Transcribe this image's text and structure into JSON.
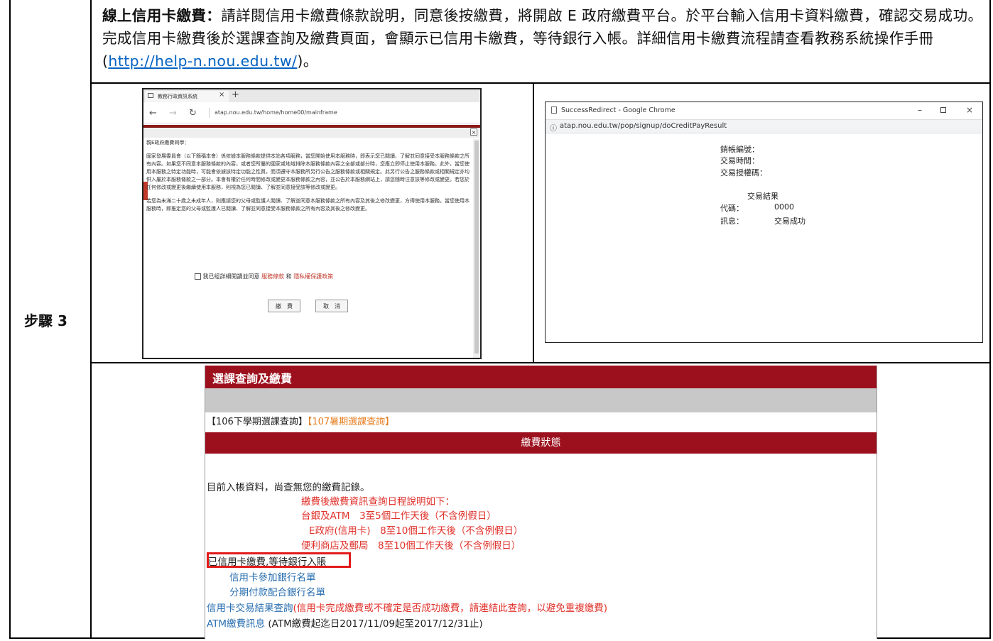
{
  "step": {
    "label": "步驟 3"
  },
  "intro": {
    "heading": "線上信用卡繳費：",
    "text": "請詳閱信用卡繳費條款說明，同意後按繳費，將開啟 E 政府繳費平台。於平台輸入信用卡資料繳費，確認交易成功。完成信用卡繳費後於選課查詢及繳費頁面，會顯示已信用卡繳費，等待銀行入帳。詳細信用卡繳費流程請查看教務系統操作手冊(",
    "link": "http://help-n.nou.edu.tw/",
    "tail": ")。"
  },
  "shot1": {
    "tab_title": "教務行政資訊系統",
    "url": "atap.nou.edu.tw/home/home00/mainframe",
    "greeting": "親E政府繳費同學：",
    "para1": "國家發展委員會（以下簡稱本會）係依據本服務條款提供本站各項服務，當您開始使用本服務時，即表示您已閱讀、了解並同意接受本服務條款之所有內容。如果您不同意本服務條款的內容，或者您所屬的國家或地域排除本服務條款內容之全部或部分時，您應立即停止使用本服務。此外，當您使用本服務之特定功能時，可能會依據該特定功能之性質，而須遵守本服務所另行公告之服務條款或相關規定。此另行公告之服務條款或相關規定亦均併入屬於本服務條款之一部分。本會有權於任何時間修改或變更本服務條款之內容，並公告於本服務網站上，請您隨時注意該等修改或變更。若您於任何修改或變更後繼續使用本服務，則視為您已閱讀、了解並同意接受該等修改或變更。",
    "para2": "若您為未滿二十歲之未成年人，則應請您的父母或監護人閱讀、了解並同意本服務條款之所有內容及其後之修改變更，方得使用本服務。當您使用本服務時，即推定您的父母或監護人已閱讀、了解並同意接受本服務條款之所有內容及其後之修改變更。",
    "agree_prefix": "我已經詳細閱讀並同意",
    "terms_link": "服務條款",
    "and": "和",
    "privacy_link": "隱私權保護政策",
    "pay_button": "繳　費",
    "cancel_button": "取　消"
  },
  "shot2": {
    "window_title": "SuccessRedirect - Google Chrome",
    "url": "atap.nou.edu.tw/pop/signup/doCreditPayResult",
    "account_label": "銷帳編號：",
    "time_label": "交易時間：",
    "auth_label": "交易授權碼：",
    "result_title": "交易結果",
    "code_label": "代碼：",
    "code_value": "0000",
    "msg_label": "訊息：",
    "msg_value": "交易成功"
  },
  "shot3": {
    "header": "選課查詢及繳費",
    "link_106": "【106下學期選課查詢】",
    "link_107": "【107暑期選課查詢】",
    "status_title": "繳費狀態",
    "no_record": "目前入帳資料，尚查無您的繳費記錄。",
    "info_title": "繳費後繳費資訊查詢日程說明如下：",
    "info_atm": "台銀及ATM　3至5個工作天後（不含例假日）",
    "info_egov": "E政府(信用卡)　8至10個工作天後（不含例假日）",
    "info_store": "便利商店及郵局　8至10個工作天後（不含例假日）",
    "paid_status": "已信用卡繳費,等待銀行入賬",
    "bank_list": "信用卡參加銀行名單",
    "installment_list": "分期付款配合銀行名單",
    "result_link": "信用卡交易結果查詢",
    "result_note": "(信用卡完成繳費或不確定是否成功繳費，請連結此查詢，以避免重複繳費)",
    "atm_link": "ATM繳費訊息",
    "atm_note": " (ATM繳費起迄日2017/11/09起至2017/12/31止)"
  }
}
